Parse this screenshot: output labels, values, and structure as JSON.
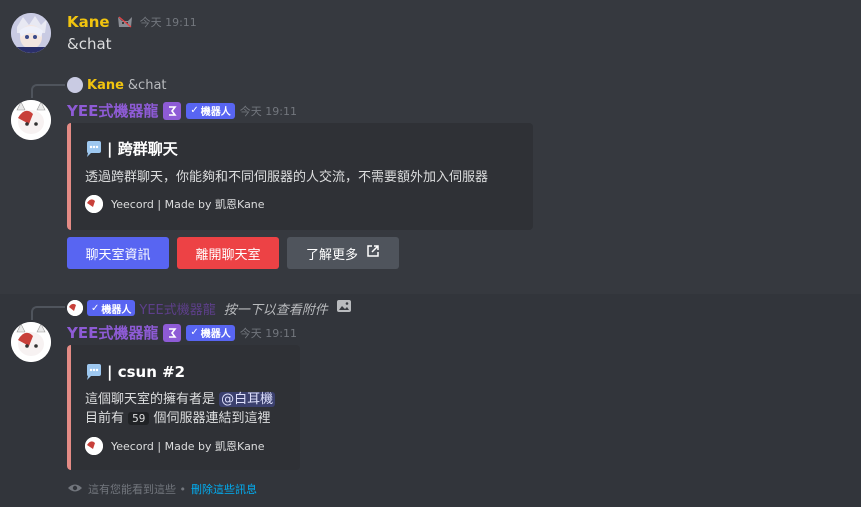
{
  "msg1": {
    "username": "Kane",
    "timestamp": "今天 19:11",
    "content": "&chat"
  },
  "reply1": {
    "username": "Kane",
    "content": "&chat"
  },
  "bot": {
    "name": "YEE式機器龍",
    "badge_label": "機器人",
    "timestamp": "今天 19:11",
    "name_color": "#8e5bd6"
  },
  "embed1": {
    "title": "| 跨群聊天",
    "description": "透過跨群聊天，你能夠和不同伺服器的人交流，不需要額外加入伺服器",
    "footer": "Yeecord | Made by 凱恩Kane",
    "accent": "#e48b85"
  },
  "buttons": {
    "info": "聊天室資訊",
    "leave": "離開聊天室",
    "learn": "了解更多"
  },
  "reply2": {
    "badge_label": "機器人",
    "name": "YEE式機器龍",
    "content": "按一下以查看附件"
  },
  "embed2": {
    "title": "| csun #2",
    "line1_prefix": "這個聊天室的擁有者是",
    "mention": "@白耳機",
    "line2_prefix": "目前有",
    "count": "59",
    "line2_suffix": "個伺服器連結到這裡",
    "footer": "Yeecord | Made by 凱恩Kane"
  },
  "ephemeral": {
    "notice": "這有您能看到這些 •",
    "dismiss": "刪除這些訊息"
  },
  "colors": {
    "blurple": "#5865f2",
    "red": "#ed4245",
    "grey": "#4f545c",
    "link": "#00aff4",
    "username_yellow": "#f1c40f"
  }
}
